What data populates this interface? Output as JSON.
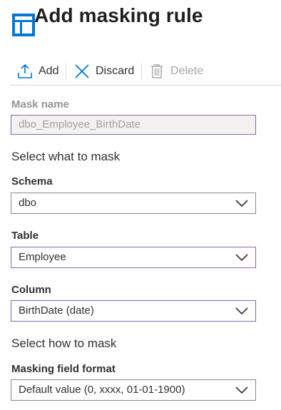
{
  "header": {
    "title": "Add masking rule"
  },
  "toolbar": {
    "add_label": "Add",
    "discard_label": "Discard",
    "delete_label": "Delete"
  },
  "form": {
    "mask_name": {
      "label": "Mask name",
      "value": "dbo_Employee_BirthDate"
    },
    "section_what": "Select what to mask",
    "schema": {
      "label": "Schema",
      "value": "dbo"
    },
    "table": {
      "label": "Table",
      "value": "Employee"
    },
    "column": {
      "label": "Column",
      "value": "BirthDate (date)"
    },
    "section_how": "Select how to mask",
    "masking_format": {
      "label": "Masking field format",
      "value": "Default value (0, xxxx, 01-01-1900)"
    }
  },
  "colors": {
    "accent_purple": "#8764b8",
    "icon_blue": "#0078d4",
    "disabled_text": "#a6a6a6"
  },
  "icons": [
    "blade-icon",
    "upload-icon",
    "close-icon",
    "trash-icon",
    "chevron-down-icon"
  ]
}
